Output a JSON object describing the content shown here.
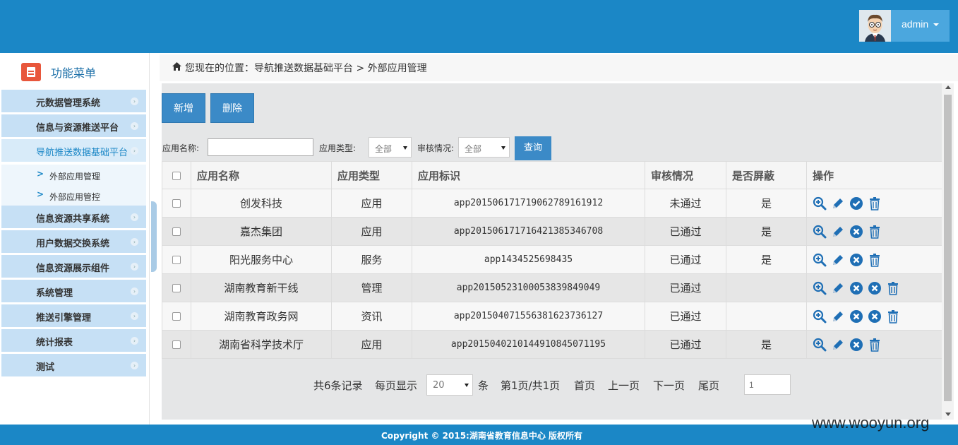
{
  "header": {
    "user_name": "admin",
    "brand_color": "#1b87c6"
  },
  "sidebar": {
    "title": "功能菜单",
    "items": [
      {
        "label": "元数据管理系统"
      },
      {
        "label": "信息与资源推送平台"
      },
      {
        "label": "导航推送数据基础平台",
        "active": true
      },
      {
        "label": "信息资源共享系统"
      },
      {
        "label": "用户数据交换系统"
      },
      {
        "label": "信息资源展示组件"
      },
      {
        "label": "系统管理"
      },
      {
        "label": "推送引擎管理"
      },
      {
        "label": "统计报表"
      },
      {
        "label": "测试"
      }
    ],
    "sub_items": [
      {
        "label": "外部应用管理"
      },
      {
        "label": "外部应用管控"
      }
    ]
  },
  "breadcrumb": {
    "text": "您现在的位置：导航推送数据基础平台 > 外部应用管理"
  },
  "toolbar": {
    "add_label": "新增",
    "delete_label": "删除"
  },
  "filters": {
    "name_label": "应用名称:",
    "name_value": "",
    "type_label": "应用类型:",
    "type_value": "全部",
    "audit_label": "审核情况:",
    "audit_value": "全部",
    "query_label": "查询"
  },
  "table": {
    "columns": [
      "应用名称",
      "应用类型",
      "应用标识",
      "审核情况",
      "是否屏蔽",
      "操作"
    ],
    "rows": [
      {
        "name": "创发科技",
        "type": "应用",
        "id": "app20150617171906278916191​2",
        "audit": "未通过",
        "blocked": "是"
      },
      {
        "name": "嘉杰集团",
        "type": "应用",
        "id": "app20150617171642138534670​8",
        "audit": "已通过",
        "blocked": "是"
      },
      {
        "name": "阳光服务中心",
        "type": "服务",
        "id": "app1434525698435",
        "audit": "已通过",
        "blocked": "是"
      },
      {
        "name": "湖南教育新干线",
        "type": "管理",
        "id": "app20150523100053839849049",
        "audit": "已通过",
        "blocked": ""
      },
      {
        "name": "湖南教育政务网",
        "type": "资讯",
        "id": "app20150407155638162373612​7",
        "audit": "已通过",
        "blocked": ""
      },
      {
        "name": "湖南省科学技术厅",
        "type": "应用",
        "id": "app20150402101449108450711​95",
        "audit": "已通过",
        "blocked": "是"
      }
    ]
  },
  "pager": {
    "total": "共6条记录",
    "per_page_label": "每页显示",
    "per_page_value": "20",
    "unit": "条",
    "page_info": "第1页/共1页",
    "first": "首页",
    "prev": "上一页",
    "next": "下一页",
    "last": "尾页",
    "jump_value": "1"
  },
  "footer": {
    "copyright": "Copyright © 2015:湖南省教育信息中心 版权所有"
  },
  "watermark": "www.wooyun.org",
  "colors": {
    "icon_blue": "#1f6fb5",
    "button_blue": "#3b8ac7"
  }
}
